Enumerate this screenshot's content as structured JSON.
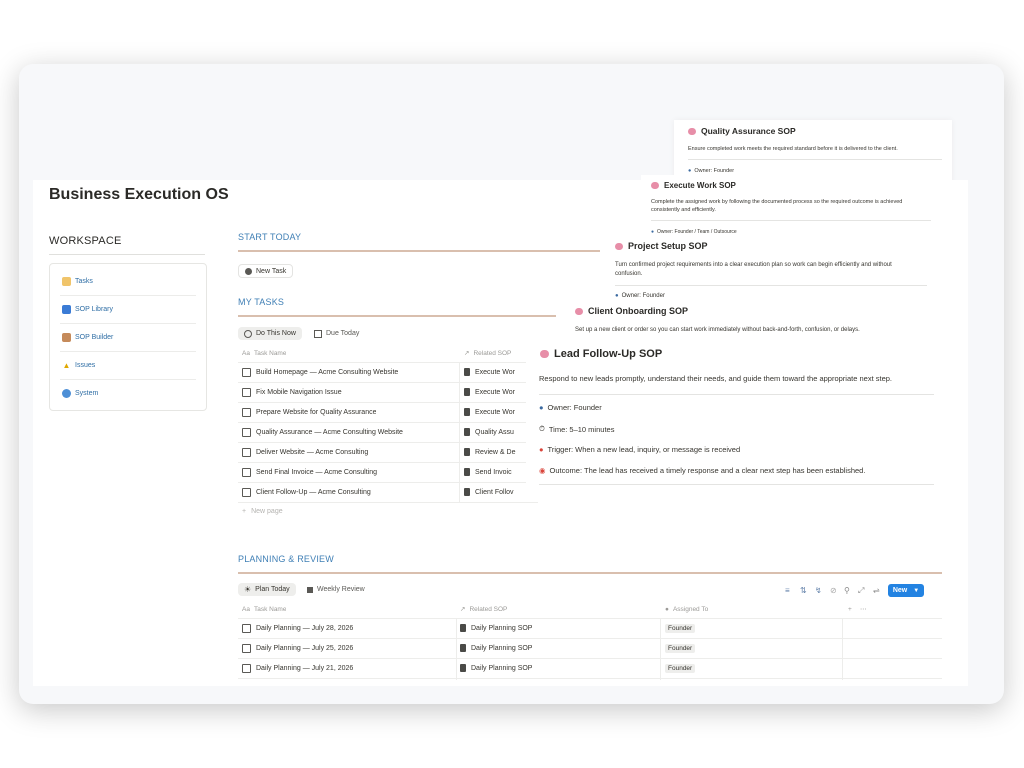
{
  "page_title": "Business Execution OS",
  "workspace": {
    "heading": "WORKSPACE",
    "items": [
      {
        "label": "Tasks",
        "icon": "notepad-icon"
      },
      {
        "label": "SOP Library",
        "icon": "book-icon"
      },
      {
        "label": "SOP Builder",
        "icon": "pen-icon"
      },
      {
        "label": "Issues",
        "icon": "warning-icon"
      },
      {
        "label": "System",
        "icon": "gear-icon"
      }
    ]
  },
  "start_today": {
    "heading": "START TODAY",
    "new_task_label": "New Task"
  },
  "my_tasks": {
    "heading": "MY TASKS",
    "views": [
      "Do This Now",
      "Due Today"
    ],
    "columns": [
      "Task Name",
      "Related SOP"
    ],
    "rows": [
      {
        "task": "Build Homepage — Acme Consulting Website",
        "sop": "Execute Wor"
      },
      {
        "task": "Fix Mobile Navigation Issue",
        "sop": "Execute Wor"
      },
      {
        "task": "Prepare Website for Quality Assurance",
        "sop": "Execute Wor"
      },
      {
        "task": "Quality Assurance — Acme Consulting Website",
        "sop": "Quality Assu"
      },
      {
        "task": "Deliver Website — Acme Consulting",
        "sop": "Review & De"
      },
      {
        "task": "Send Final Invoice — Acme Consulting",
        "sop": "Send Invoic"
      },
      {
        "task": "Client Follow-Up — Acme Consulting",
        "sop": "Client Follov"
      }
    ],
    "new_page_label": "New page"
  },
  "planning": {
    "heading": "PLANNING & REVIEW",
    "views": [
      "Plan Today",
      "Weekly Review"
    ],
    "new_button": "New",
    "columns": [
      "Task Name",
      "Related SOP",
      "Assigned To"
    ],
    "rows": [
      {
        "task": "Daily Planning — July 28, 2026",
        "sop": "Daily Planning SOP",
        "assignee": "Founder"
      },
      {
        "task": "Daily Planning — July 25, 2026",
        "sop": "Daily Planning SOP",
        "assignee": "Founder"
      },
      {
        "task": "Daily Planning — July 21, 2026",
        "sop": "Daily Planning SOP",
        "assignee": "Founder"
      }
    ]
  },
  "sop_cards": {
    "quality_assurance": {
      "title": "Quality Assurance SOP",
      "description": "Ensure completed work meets the required standard before it is delivered to the client.",
      "owner": "Owner: Founder"
    },
    "execute_work": {
      "title": "Execute Work SOP",
      "description_1": "Complete the assigned work by following the documented process so the required outcome is achieved",
      "description_2": "consistently and efficiently.",
      "owner": "Owner: Founder / Team / Outsource"
    },
    "project_setup": {
      "title": "Project Setup SOP",
      "description_1": "Turn confirmed project requirements into a clear execution plan so work can begin efficiently and without",
      "description_2": "confusion.",
      "owner": "Owner: Founder"
    },
    "client_onboarding": {
      "title": "Client Onboarding SOP",
      "description": "Set up a new client or order so you can start work immediately without back-and-forth, confusion, or delays."
    },
    "lead_follow_up": {
      "title": "Lead Follow-Up SOP",
      "description": "Respond to new leads promptly, understand their needs, and guide them toward the appropriate next step.",
      "owner": "Owner: Founder",
      "time": "Time: 5–10 minutes",
      "trigger": "Trigger: When a new lead, inquiry, or message is received",
      "outcome": "Outcome: The lead has received a timely response and a clear next step has been established."
    }
  },
  "colors": {
    "accent_blue": "#2383e2",
    "link_blue": "#3f7fb5",
    "rule_tan": "#d9bfae"
  }
}
